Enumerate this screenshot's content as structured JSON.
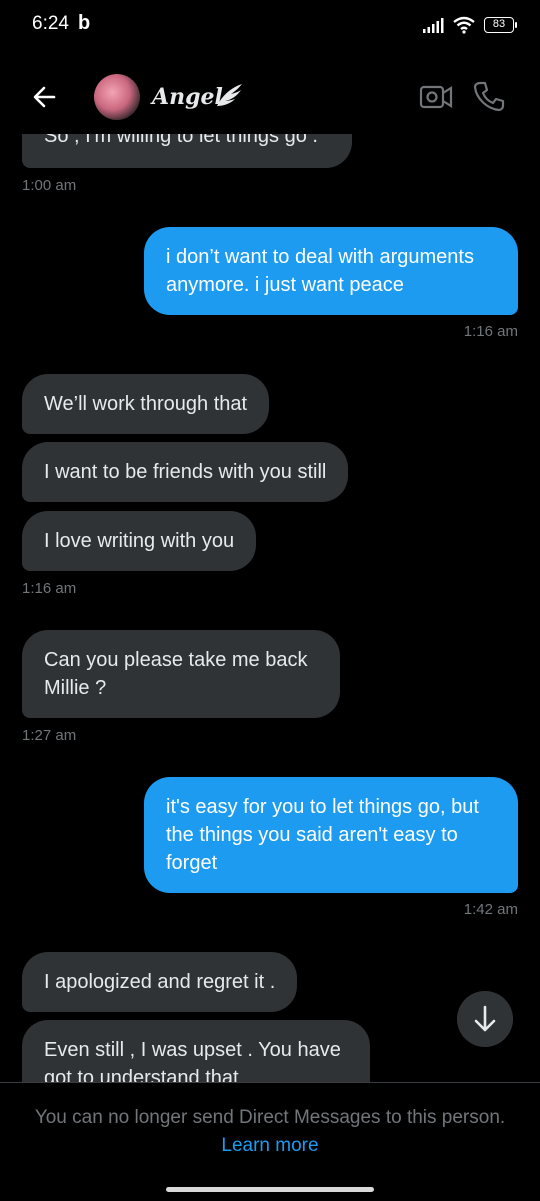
{
  "status_bar": {
    "time": "6:24",
    "app_glyph": "b",
    "battery": "83"
  },
  "header": {
    "contact_name": "Angel"
  },
  "messages": [
    {
      "side": "in",
      "text": "So , I'm willing to let things go ."
    },
    {
      "time": "1:00 am"
    },
    {
      "side": "out",
      "text": "i don’t want to deal with arguments anymore. i just want peace"
    },
    {
      "time": "1:16 am"
    },
    {
      "side": "in",
      "text": "We’ll work through that"
    },
    {
      "side": "in",
      "text": "I want to be friends with you still"
    },
    {
      "side": "in",
      "text": "I love writing with you"
    },
    {
      "time": "1:16 am"
    },
    {
      "side": "in",
      "text": "Can you please take me back Millie ?"
    },
    {
      "time": "1:27 am"
    },
    {
      "side": "out",
      "text": "it's easy for you to let things go, but the things you said aren't easy to forget"
    },
    {
      "time": "1:42 am"
    },
    {
      "side": "in",
      "text": "I apologized and regret it ."
    },
    {
      "side": "in",
      "text": "Even still , I was upset . You have got to understand that"
    }
  ],
  "footer": {
    "notice": "You can no longer send Direct Messages to this person.",
    "link": "Learn more"
  },
  "icons": {
    "back": "arrow-left-icon",
    "video": "video-camera-icon",
    "call": "phone-icon",
    "scroll": "arrow-down-icon",
    "wing": "angel-wing-icon"
  },
  "colors": {
    "background": "#000000",
    "incoming": "#2f3336",
    "outgoing": "#1d9bf0",
    "muted": "#71767b"
  }
}
